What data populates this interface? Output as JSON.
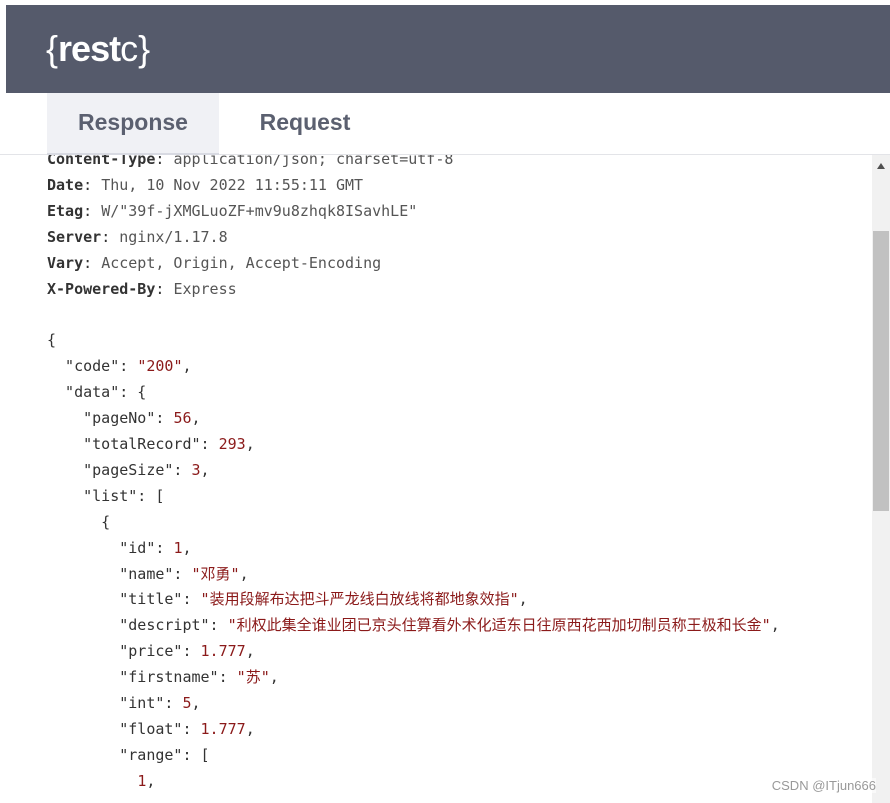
{
  "app": {
    "logo": {
      "open": "{",
      "rest": "rest",
      "c": "c",
      "close": "}"
    }
  },
  "tabs": [
    {
      "label": "Response",
      "active": true
    },
    {
      "label": "Request",
      "active": false
    }
  ],
  "headers": [
    {
      "key": "Content-Type",
      "value": "application/json; charset=utf-8"
    },
    {
      "key": "Date",
      "value": "Thu, 10 Nov 2022 11:55:11 GMT"
    },
    {
      "key": "Etag",
      "value": "W/\"39f-jXMGLuoZF+mv9u8zhqk8ISavhLE\""
    },
    {
      "key": "Server",
      "value": "nginx/1.17.8"
    },
    {
      "key": "Vary",
      "value": "Accept, Origin, Accept-Encoding"
    },
    {
      "key": "X-Powered-By",
      "value": "Express"
    }
  ],
  "body": {
    "code": "200",
    "data": {
      "pageNo": "56",
      "totalRecord": "293",
      "pageSize": "3",
      "list_item": {
        "id": "1",
        "name": "邓勇",
        "title": "装用段解布达把斗严龙线白放线将都地象效指",
        "descript": "利权此集全谁业团已京头住算看外术化适东日往原西花西加切制员称王极和长金",
        "price": "1.777",
        "firstname": "苏",
        "int": "5",
        "float": "1.777",
        "range_first": "1"
      }
    }
  },
  "watermark": "CSDN @ITjun666",
  "colors": {
    "topbar": "#555a6b",
    "string": "#8b1a1a",
    "active_tab_bg": "#f0f1f5"
  }
}
